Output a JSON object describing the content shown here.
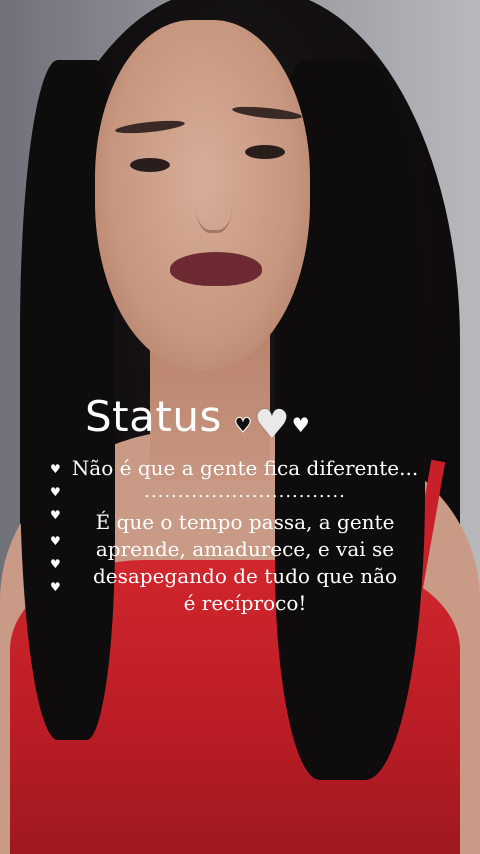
{
  "status_title": "Status",
  "title_hearts": [
    "white-heart-icon",
    "mesh-heart-icon",
    "white-heart-icon"
  ],
  "text_lines": [
    "Não é que a gente fica diferente...",
    "..............................",
    "É que o tempo passa, a gente",
    "aprende, amadurece, e vai se",
    "desapegando de tudo que não",
    "é recíproco!"
  ],
  "side_heart_count": 6,
  "colors": {
    "text": "#ffffff",
    "dress": "#c8202a",
    "hair": "#0f0c0d",
    "wall": "#8e8f96"
  }
}
